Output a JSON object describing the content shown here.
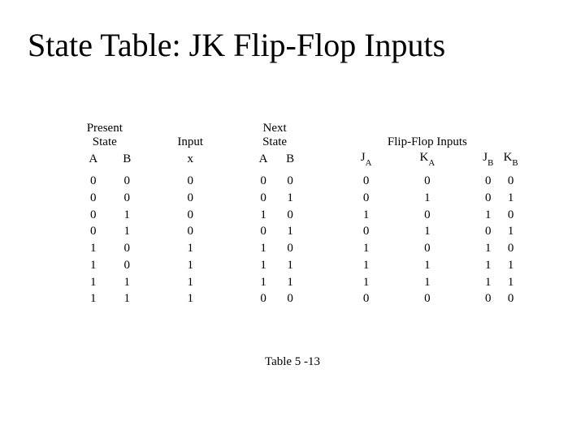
{
  "title": "State Table: JK Flip-Flop Inputs",
  "caption": "Table 5 -13",
  "groups": {
    "present_state": "Present\nState",
    "input": "Input",
    "next_state": "Next\nState",
    "ff_inputs": "Flip-Flop Inputs"
  },
  "columns": {
    "ps_A": "A",
    "ps_B": "B",
    "in_x": "x",
    "ns_A": "A",
    "ns_B": "B",
    "J": "J",
    "K": "K",
    "sub_A": "A",
    "sub_B": "B"
  },
  "chart_data": {
    "type": "table",
    "title": "State Table: JK Flip-Flop Inputs",
    "column_groups": [
      {
        "name": "Present State",
        "columns": [
          "A",
          "B"
        ]
      },
      {
        "name": "Input",
        "columns": [
          "x"
        ]
      },
      {
        "name": "Next State",
        "columns": [
          "A",
          "B"
        ]
      },
      {
        "name": "Flip-Flop Inputs",
        "columns": [
          "J_A",
          "K_A",
          "J_B",
          "K_B"
        ]
      }
    ],
    "rows": [
      {
        "ps_A": 0,
        "ps_B": 0,
        "x": 0,
        "ns_A": 0,
        "ns_B": 0,
        "JA": 0,
        "KA": 0,
        "JB": 0,
        "KB": 0
      },
      {
        "ps_A": 0,
        "ps_B": 0,
        "x": 0,
        "ns_A": 0,
        "ns_B": 1,
        "JA": 0,
        "KA": 1,
        "JB": 0,
        "KB": 1
      },
      {
        "ps_A": 0,
        "ps_B": 1,
        "x": 0,
        "ns_A": 1,
        "ns_B": 0,
        "JA": 1,
        "KA": 0,
        "JB": 1,
        "KB": 0
      },
      {
        "ps_A": 0,
        "ps_B": 1,
        "x": 0,
        "ns_A": 0,
        "ns_B": 1,
        "JA": 0,
        "KA": 1,
        "JB": 0,
        "KB": 1
      },
      {
        "ps_A": 1,
        "ps_B": 0,
        "x": 1,
        "ns_A": 1,
        "ns_B": 0,
        "JA": 1,
        "KA": 0,
        "JB": 1,
        "KB": 0
      },
      {
        "ps_A": 1,
        "ps_B": 0,
        "x": 1,
        "ns_A": 1,
        "ns_B": 1,
        "JA": 1,
        "KA": 1,
        "JB": 1,
        "KB": 1
      },
      {
        "ps_A": 1,
        "ps_B": 1,
        "x": 1,
        "ns_A": 1,
        "ns_B": 1,
        "JA": 1,
        "KA": 1,
        "JB": 1,
        "KB": 1
      },
      {
        "ps_A": 1,
        "ps_B": 1,
        "x": 1,
        "ns_A": 0,
        "ns_B": 0,
        "JA": 0,
        "KA": 0,
        "JB": 0,
        "KB": 0
      }
    ]
  }
}
